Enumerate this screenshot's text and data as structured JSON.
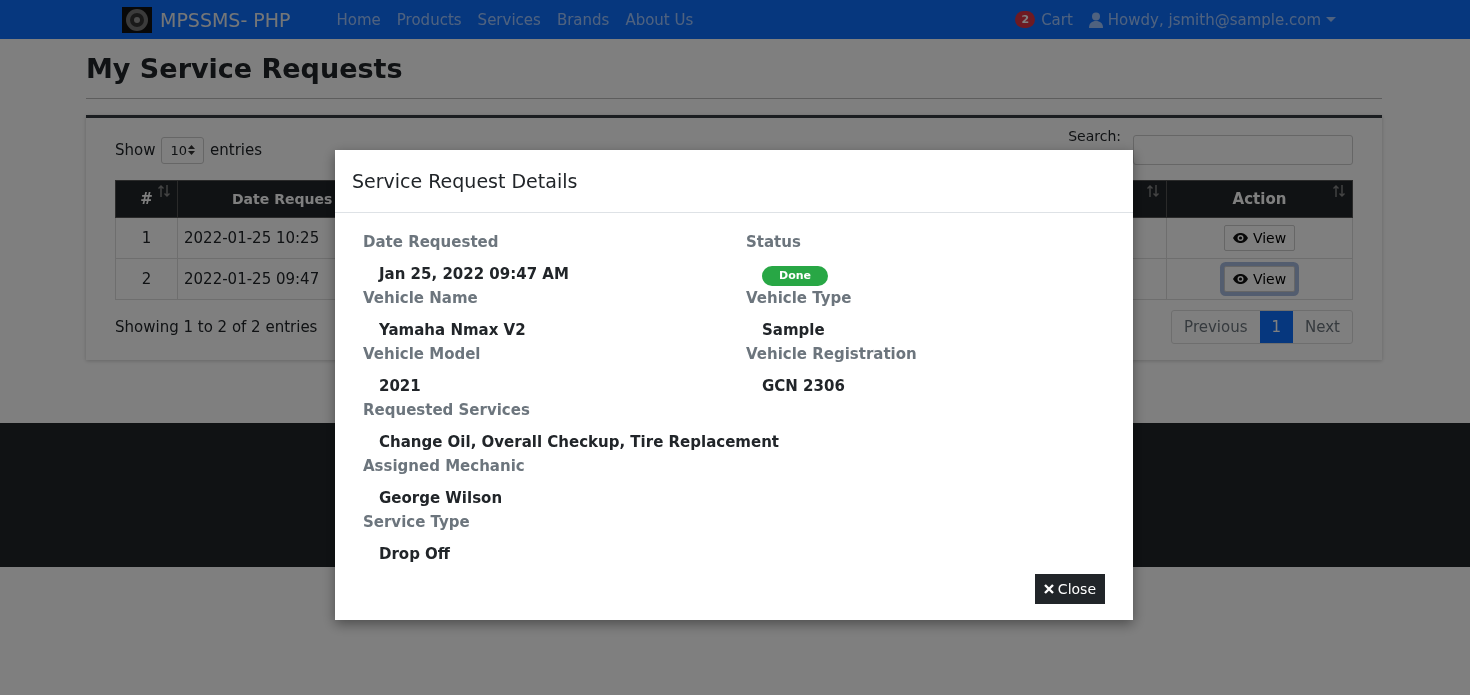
{
  "navbar": {
    "brand": "MPSSMS- PHP",
    "links": [
      "Home",
      "Products",
      "Services",
      "Brands",
      "About Us"
    ],
    "cart_count": "2",
    "cart_label": "Cart",
    "user": "Howdy, jsmith@sample.com"
  },
  "page": {
    "title": "My Service Requests"
  },
  "table_card": {
    "show_label": "Show",
    "entries_value": "10",
    "entries_label": "entries",
    "search_label": "Search:",
    "columns": [
      "#",
      "Date Reques",
      "Action"
    ],
    "rows": [
      {
        "number": "1",
        "date": "2022-01-25 10:25",
        "action": "View",
        "focused": false
      },
      {
        "number": "2",
        "date": "2022-01-25 09:47",
        "action": "View",
        "focused": true
      }
    ],
    "info": "Showing 1 to 2 of 2 entries",
    "pagination": [
      {
        "label": "Previous",
        "selected": false
      },
      {
        "label": "1",
        "selected": true
      },
      {
        "label": "Next",
        "selected": false
      }
    ]
  },
  "modal": {
    "title": "Service Request Details",
    "left_fields": [
      {
        "kind": "text",
        "label": "Date Requested",
        "value": "Jan 25, 2022 09:47 AM"
      },
      {
        "kind": "text",
        "label": "Vehicle Name",
        "value": "Yamaha Nmax V2"
      },
      {
        "kind": "text",
        "label": "Vehicle Model",
        "value": "2021"
      },
      {
        "kind": "text",
        "label": "Requested Services",
        "value": "Change Oil, Overall Checkup, Tire Replacement"
      },
      {
        "kind": "text",
        "label": "Assigned Mechanic",
        "value": "George Wilson"
      },
      {
        "kind": "text",
        "label": "Service Type",
        "value": "Drop Off"
      }
    ],
    "right_fields": [
      {
        "kind": "badge",
        "label": "Status",
        "value": "Done",
        "color": "#28a745"
      },
      {
        "kind": "text",
        "label": "Vehicle Type",
        "value": "Sample"
      },
      {
        "kind": "text",
        "label": "Vehicle Registration",
        "value": "GCN 2306"
      }
    ],
    "close_button": "Close"
  }
}
